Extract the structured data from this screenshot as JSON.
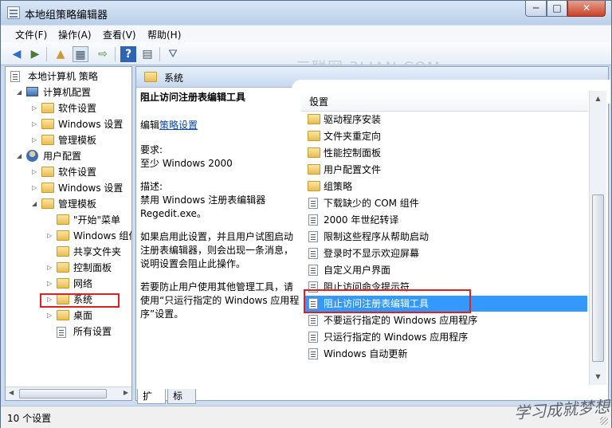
{
  "window": {
    "title": "本地组策略编辑器",
    "controls": {
      "minimize": "─",
      "maximize": "□",
      "close": "✕"
    }
  },
  "menu": [
    "文件(F)",
    "操作(A)",
    "查看(V)",
    "帮助(H)"
  ],
  "watermark": "三联网 3LIAN.COM",
  "tree": {
    "root": "本地计算机 策略",
    "items": [
      {
        "label": "计算机配置",
        "level": 1,
        "expander": "◢",
        "icon": "pc-icon"
      },
      {
        "label": "软件设置",
        "level": 2,
        "expander": "▷",
        "icon": "folder-icon"
      },
      {
        "label": "Windows 设置",
        "level": 2,
        "expander": "▷",
        "icon": "folder-icon"
      },
      {
        "label": "管理模板",
        "level": 2,
        "expander": "▷",
        "icon": "folder-icon"
      },
      {
        "label": "用户配置",
        "level": 1,
        "expander": "◢",
        "icon": "user-icon"
      },
      {
        "label": "软件设置",
        "level": 2,
        "expander": "▷",
        "icon": "folder-icon"
      },
      {
        "label": "Windows 设置",
        "level": 2,
        "expander": "▷",
        "icon": "folder-icon"
      },
      {
        "label": "管理模板",
        "level": 2,
        "expander": "◢",
        "icon": "folder-icon"
      },
      {
        "label": "\"开始\"菜单",
        "level": 3,
        "expander": "",
        "icon": "folder-icon"
      },
      {
        "label": "Windows 组件",
        "level": 3,
        "expander": "▷",
        "icon": "folder-icon"
      },
      {
        "label": "共享文件夹",
        "level": 3,
        "expander": "",
        "icon": "folder-icon"
      },
      {
        "label": "控制面板",
        "level": 3,
        "expander": "▷",
        "icon": "folder-icon"
      },
      {
        "label": "网络",
        "level": 3,
        "expander": "▷",
        "icon": "folder-icon"
      },
      {
        "label": "系统",
        "level": 3,
        "expander": "▷",
        "icon": "folder-icon"
      },
      {
        "label": "桌面",
        "level": 3,
        "expander": "▷",
        "icon": "folder-icon"
      },
      {
        "label": "所有设置",
        "level": 3,
        "expander": "",
        "icon": "settings-icon"
      }
    ]
  },
  "right": {
    "header": "系统",
    "desc": {
      "title": "阻止访问注册表编辑工具",
      "edit_prefix": "编辑",
      "edit_link": "策略设置",
      "req_label": "要求:",
      "req_value": "至少 Windows 2000",
      "desc_label": "描述:",
      "desc_value": "禁用 Windows 注册表编辑器 Regedit.exe。",
      "para1": "如果启用此设置，并且用户试图启动注册表编辑器，则会出现一条消息，说明设置会阻止此操作。",
      "para2": "若要防止用户使用其他管理工具，请使用“只运行指定的 Windows 应用程序”设置。"
    },
    "column": "设置",
    "rows": [
      {
        "label": "驱动程序安装",
        "type": "folder"
      },
      {
        "label": "文件夹重定向",
        "type": "folder"
      },
      {
        "label": "性能控制面板",
        "type": "folder"
      },
      {
        "label": "用户配置文件",
        "type": "folder"
      },
      {
        "label": "组策略",
        "type": "folder"
      },
      {
        "label": "下载缺少的 COM 组件",
        "type": "setting"
      },
      {
        "label": "2000 年世纪转译",
        "type": "setting"
      },
      {
        "label": "限制这些程序从帮助启动",
        "type": "setting"
      },
      {
        "label": "登录时不显示欢迎屏幕",
        "type": "setting"
      },
      {
        "label": "自定义用户界面",
        "type": "setting"
      },
      {
        "label": "阻止访问命令提示符",
        "type": "setting"
      },
      {
        "label": "阻止访问注册表编辑工具",
        "type": "setting",
        "selected": true
      },
      {
        "label": "不要运行指定的 Windows 应用程序",
        "type": "setting"
      },
      {
        "label": "只运行指定的 Windows 应用程序",
        "type": "setting"
      },
      {
        "label": "Windows 自动更新",
        "type": "setting"
      }
    ]
  },
  "tabs": [
    "扩展",
    "标准"
  ],
  "status": "10 个设置",
  "signature": "学习成就梦想"
}
